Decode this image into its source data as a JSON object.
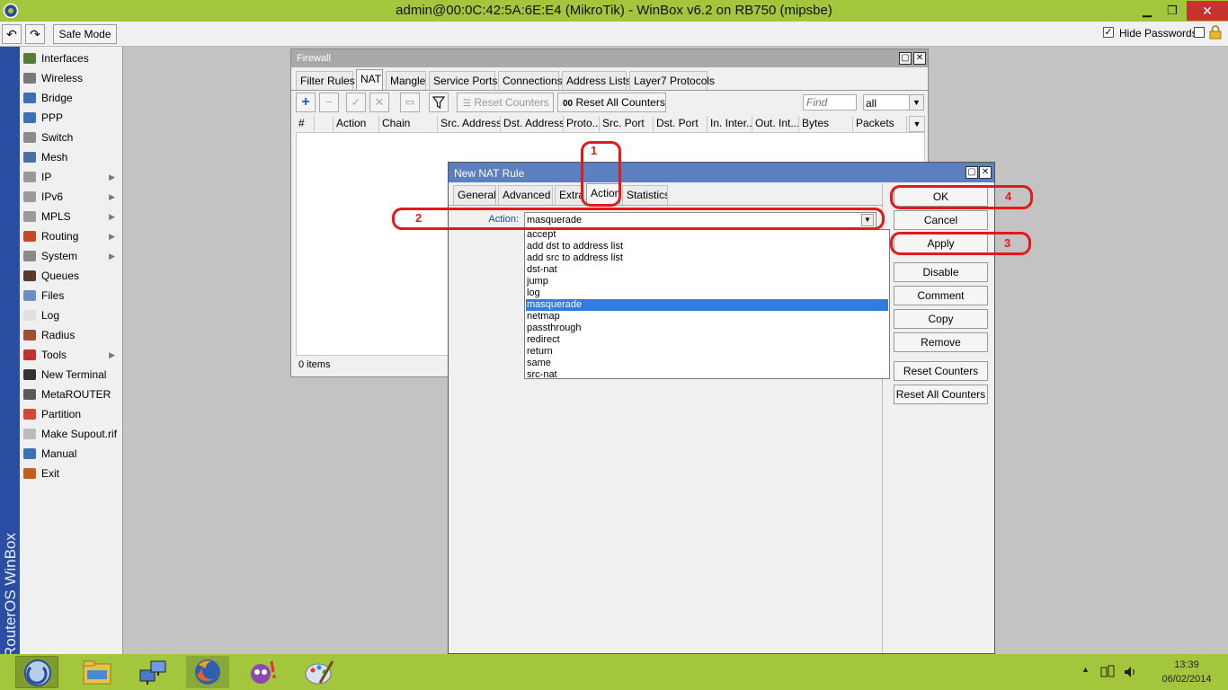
{
  "window": {
    "title": "admin@00:0C:42:5A:6E:E4 (MikroTik) - WinBox v6.2 on RB750 (mipsbe)",
    "minimize": "▁",
    "maximize": "❐",
    "close": "✕"
  },
  "toolbar": {
    "undo": "↶",
    "redo": "↷",
    "safe_mode": "Safe Mode",
    "hide_passwords_label": "Hide Passwords",
    "hide_passwords_checked": true
  },
  "brand": "RouterOS WinBox",
  "menu": [
    {
      "label": "Interfaces",
      "icon": "interfaces-icon",
      "color": "#5a7a3a",
      "sub": false
    },
    {
      "label": "Wireless",
      "icon": "wireless-icon",
      "color": "#7a7a7a",
      "sub": false
    },
    {
      "label": "Bridge",
      "icon": "bridge-icon",
      "color": "#3b6fb6",
      "sub": false
    },
    {
      "label": "PPP",
      "icon": "ppp-icon",
      "color": "#3b6fb6",
      "sub": false
    },
    {
      "label": "Switch",
      "icon": "switch-icon",
      "color": "#8a8a8a",
      "sub": false
    },
    {
      "label": "Mesh",
      "icon": "mesh-icon",
      "color": "#4a6fa5",
      "sub": false
    },
    {
      "label": "IP",
      "icon": "ip-icon",
      "color": "#9a9a9a",
      "sub": true
    },
    {
      "label": "IPv6",
      "icon": "ipv6-icon",
      "color": "#9a9a9a",
      "sub": true
    },
    {
      "label": "MPLS",
      "icon": "mpls-icon",
      "color": "#9a9a9a",
      "sub": true
    },
    {
      "label": "Routing",
      "icon": "routing-icon",
      "color": "#c24a2a",
      "sub": true
    },
    {
      "label": "System",
      "icon": "system-icon",
      "color": "#8a8a8a",
      "sub": true
    },
    {
      "label": "Queues",
      "icon": "queues-icon",
      "color": "#5a3a2a",
      "sub": false
    },
    {
      "label": "Files",
      "icon": "files-icon",
      "color": "#6a8fc5",
      "sub": false
    },
    {
      "label": "Log",
      "icon": "log-icon",
      "color": "#e0e0e0",
      "sub": false
    },
    {
      "label": "Radius",
      "icon": "radius-icon",
      "color": "#a05030",
      "sub": false
    },
    {
      "label": "Tools",
      "icon": "tools-icon",
      "color": "#c23030",
      "sub": true
    },
    {
      "label": "New Terminal",
      "icon": "terminal-icon",
      "color": "#333333",
      "sub": false
    },
    {
      "label": "MetaROUTER",
      "icon": "metarouter-icon",
      "color": "#5a5a5a",
      "sub": false
    },
    {
      "label": "Partition",
      "icon": "partition-icon",
      "color": "#d04a3a",
      "sub": false
    },
    {
      "label": "Make Supout.rif",
      "icon": "supout-icon",
      "color": "#bbbbbb",
      "sub": false
    },
    {
      "label": "Manual",
      "icon": "manual-icon",
      "color": "#3b6fb6",
      "sub": false
    },
    {
      "label": "Exit",
      "icon": "exit-icon",
      "color": "#c06020",
      "sub": false
    }
  ],
  "firewall": {
    "title": "Firewall",
    "tabs": [
      "Filter Rules",
      "NAT",
      "Mangle",
      "Service Ports",
      "Connections",
      "Address Lists",
      "Layer7 Protocols"
    ],
    "active_tab": "NAT",
    "reset_counters": "Reset Counters",
    "reset_all_counters": "Reset All Counters",
    "reset_all_prefix": "00",
    "find_placeholder": "Find",
    "filter_value": "all",
    "columns": [
      "#",
      "",
      "Action",
      "Chain",
      "Src. Address",
      "Dst. Address",
      "Proto...",
      "Src. Port",
      "Dst. Port",
      "In. Inter...",
      "Out. Int...",
      "Bytes",
      "Packets"
    ],
    "status": "0 items"
  },
  "nat_rule": {
    "title": "New NAT Rule",
    "tabs": [
      "General",
      "Advanced",
      "Extra",
      "Action",
      "Statistics"
    ],
    "active_tab": "Action",
    "action_label": "Action:",
    "action_value": "masquerade",
    "options": [
      "accept",
      "add dst to address list",
      "add src to address list",
      "dst-nat",
      "jump",
      "log",
      "masquerade",
      "netmap",
      "passthrough",
      "redirect",
      "return",
      "same",
      "src-nat"
    ],
    "selected_option": "masquerade",
    "buttons": {
      "ok": "OK",
      "cancel": "Cancel",
      "apply": "Apply",
      "disable": "Disable",
      "comment": "Comment",
      "copy": "Copy",
      "remove": "Remove",
      "reset_counters": "Reset Counters",
      "reset_all_counters": "Reset All Counters"
    }
  },
  "annotations": {
    "n1": "1",
    "n2": "2",
    "n3": "3",
    "n4": "4"
  },
  "taskbar": {
    "apps": [
      "winbox-icon",
      "file-explorer-icon",
      "network-icon",
      "firefox-icon",
      "messenger-icon",
      "paint-icon"
    ],
    "time": "13:39",
    "date": "06/02/2014"
  }
}
